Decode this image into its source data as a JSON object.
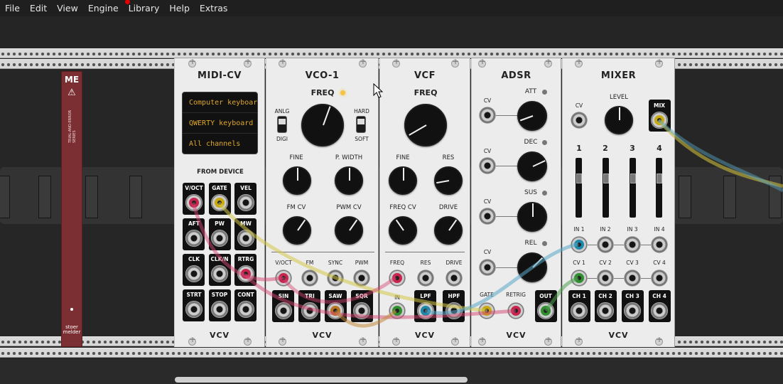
{
  "menu": [
    "File",
    "Edit",
    "View",
    "Engine",
    "Library",
    "Help",
    "Extras"
  ],
  "blank_panel": {
    "logo": "ME",
    "brand": "stoer\nmelder",
    "series": "TRIAL-AND-ERROR SERIES"
  },
  "midi": {
    "title": "MIDI-CV",
    "display": [
      "Computer keyboar",
      "QWERTY keyboard",
      "All channels"
    ],
    "from_device": "FROM DEVICE",
    "ports": [
      "V/OCT",
      "GATE",
      "VEL",
      "AFT",
      "PW",
      "MW",
      "CLK",
      "CLK/N",
      "RTRG",
      "STRT",
      "STOP",
      "CONT"
    ]
  },
  "vco": {
    "title": "VCO-1",
    "freq": "FREQ",
    "anlg": "ANLG",
    "digi": "DIGI",
    "hard": "HARD",
    "soft": "SOFT",
    "fine": "FINE",
    "pwidth": "P. WIDTH",
    "fmcv": "FM CV",
    "pwmcv": "PWM CV",
    "inputs": [
      "V/OCT",
      "FM",
      "SYNC",
      "PWM"
    ],
    "outputs": [
      "SIN",
      "TRI",
      "SAW",
      "SQR"
    ]
  },
  "vcf": {
    "title": "VCF",
    "freq": "FREQ",
    "fine": "FINE",
    "res": "RES",
    "freqcv": "FREQ CV",
    "drive": "DRIVE",
    "inputs": [
      "FREQ",
      "RES",
      "DRIVE"
    ],
    "in": "IN",
    "lpf": "LPF",
    "hpf": "HPF"
  },
  "adsr": {
    "title": "ADSR",
    "cv": "CV",
    "stages": [
      "ATT",
      "DEC",
      "SUS",
      "REL"
    ],
    "gate": "GATE",
    "retrig": "RETRIG",
    "out": "OUT"
  },
  "mixer": {
    "title": "MIXER",
    "cv": "CV",
    "level": "LEVEL",
    "mix": "MIX",
    "channels": [
      "1",
      "2",
      "3",
      "4"
    ],
    "ins": [
      "IN 1",
      "IN 2",
      "IN 3",
      "IN 4"
    ],
    "cvs": [
      "CV 1",
      "CV 2",
      "CV 3",
      "CV 4"
    ],
    "chs": [
      "CH 1",
      "CH 2",
      "CH 3",
      "CH 4"
    ]
  },
  "brand": "VCV",
  "colors": {
    "red": "#c7254e",
    "yellow": "#c9a910",
    "green": "#2f8f2f",
    "blue": "#1e88aa"
  }
}
